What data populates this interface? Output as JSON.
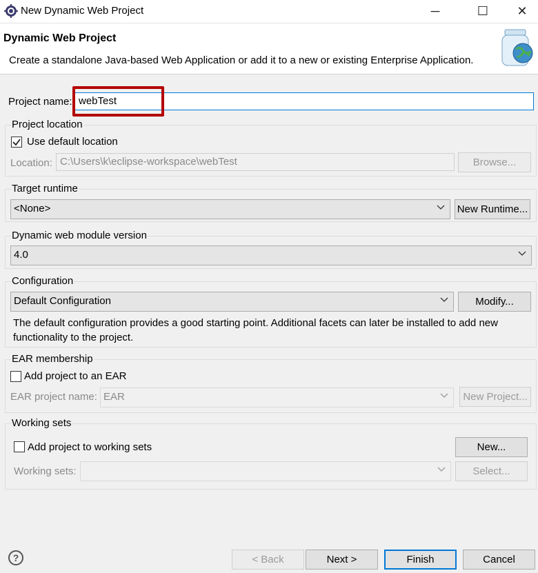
{
  "window": {
    "title": "New Dynamic Web Project",
    "minimize_glyph": "─",
    "maximize_glyph": "☐",
    "close_glyph": "✕",
    "app_icon": "eclipse-gear-icon"
  },
  "header": {
    "title": "Dynamic Web Project",
    "description": "Create a standalone Java-based Web Application or add it to a new or existing Enterprise Application.",
    "icon": "web-project-jar-globe-icon"
  },
  "project_name": {
    "label": "Project name:",
    "value": "webTest"
  },
  "project_location": {
    "group_label": "Project location",
    "use_default_label": "Use default location",
    "use_default_checked": true,
    "location_label": "Location:",
    "location_value": "C:\\Users\\k\\eclipse-workspace\\webTest",
    "browse_label": "Browse..."
  },
  "target_runtime": {
    "group_label": "Target runtime",
    "selected": "<None>",
    "new_runtime_label": "New Runtime..."
  },
  "web_module": {
    "group_label": "Dynamic web module version",
    "selected": "4.0"
  },
  "configuration": {
    "group_label": "Configuration",
    "selected": "Default Configuration",
    "modify_label": "Modify...",
    "description": "The default configuration provides a good starting point. Additional facets can later be installed to add new functionality to the project."
  },
  "ear": {
    "group_label": "EAR membership",
    "add_label": "Add project to an EAR",
    "add_checked": false,
    "name_label": "EAR project name:",
    "name_value": "EAR",
    "new_project_label": "New Project..."
  },
  "working_sets": {
    "group_label": "Working sets",
    "add_label": "Add project to working sets",
    "add_checked": false,
    "new_label": "New...",
    "sets_label": "Working sets:",
    "select_label": "Select..."
  },
  "footer": {
    "help_glyph": "?",
    "back_label": "< Back",
    "next_label": "Next >",
    "finish_label": "Finish",
    "cancel_label": "Cancel"
  },
  "colors": {
    "highlight": "#b30000",
    "focus": "#0078d7"
  }
}
